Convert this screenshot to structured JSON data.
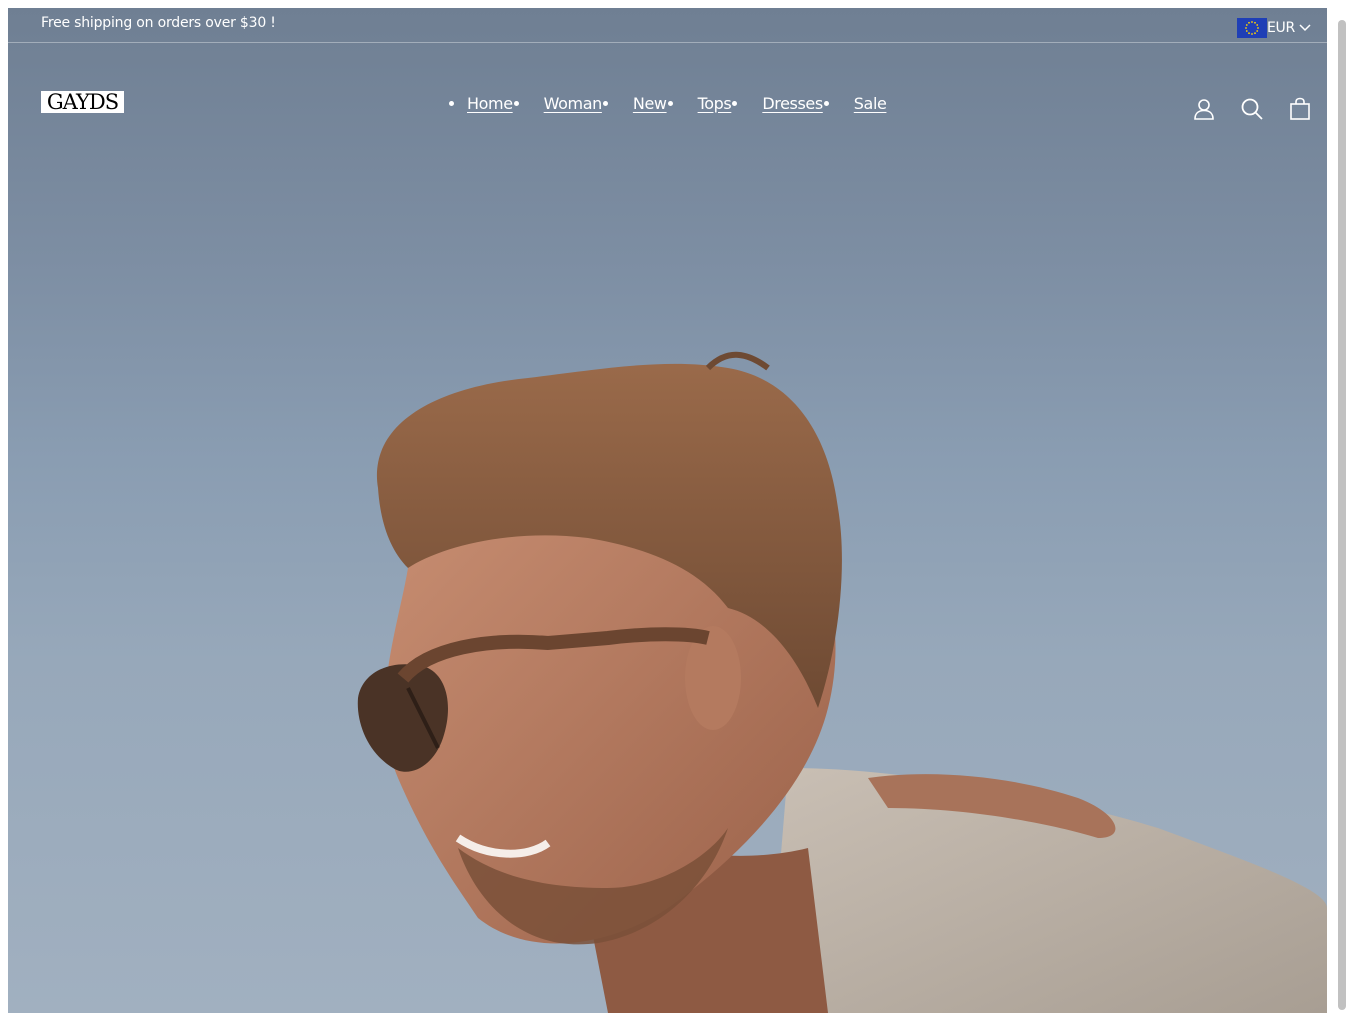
{
  "announcement": {
    "text": "Free shipping on orders over $30 !"
  },
  "currency": {
    "label": "EUR",
    "flag_icon": "eu-flag-icon"
  },
  "header": {
    "logo_text": "GAYDS",
    "nav": [
      {
        "label": "Home"
      },
      {
        "label": "Woman"
      },
      {
        "label": "New"
      },
      {
        "label": "Tops"
      },
      {
        "label": "Dresses"
      },
      {
        "label": "Sale"
      }
    ],
    "icons": [
      "account-icon",
      "search-icon",
      "cart-icon"
    ]
  },
  "colors": {
    "text": "#ffffff",
    "sky_top": "#6f7f93",
    "sky_bottom": "#a1b0c0",
    "flag_blue": "#1f3fb6"
  }
}
